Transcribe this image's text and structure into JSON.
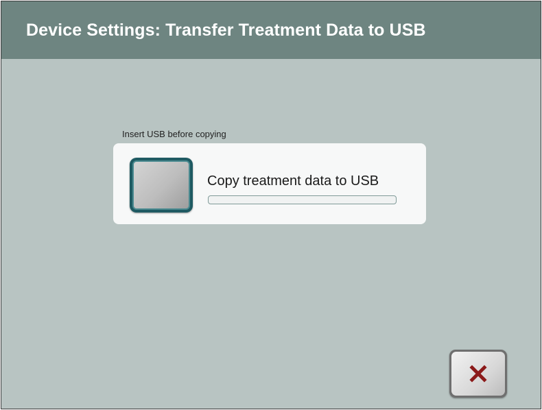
{
  "header": {
    "title": "Device Settings: Transfer Treatment Data to USB"
  },
  "main": {
    "usb_hint": "Insert USB before copying",
    "copy_action": {
      "label": "Copy treatment data to USB",
      "progress": 0
    }
  },
  "footer": {
    "close_icon": "close-icon"
  },
  "colors": {
    "header_bg": "#6e8581",
    "screen_bg": "#b8c4c2",
    "accent": "#1e5a62",
    "close_x": "#8b1a1a"
  }
}
